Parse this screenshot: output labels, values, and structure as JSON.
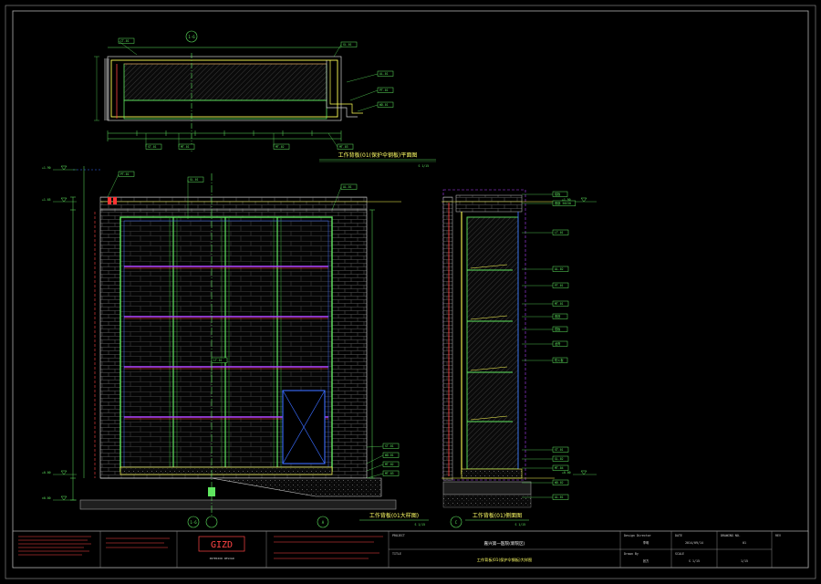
{
  "sheet": {
    "sheet_number": "01",
    "page": "1/15"
  },
  "views": {
    "plan": {
      "title": "工作背板(01(保护伞钢板)平面图",
      "scale": "S 1/15"
    },
    "front": {
      "title": "工作背板(01大样图)",
      "scale": "S 1/15"
    },
    "side": {
      "title": "工作背板(01)侧面图",
      "scale": "S 1/15"
    }
  },
  "section_markers": {
    "top": "1-6",
    "bottom": "1-6",
    "detail_a": "A",
    "detail_c": "C"
  },
  "levels": {
    "front": [
      "+1.90",
      "+1.65",
      "+0.00",
      "±0.00"
    ],
    "side": [
      "+1.90",
      "+0.00"
    ]
  },
  "annotations": {
    "plan": [
      "CT-01",
      "GL-01",
      "AL-01",
      "PT-01",
      "WD-01",
      "ST-01",
      "MT-01",
      "MT-02",
      "MT-03"
    ],
    "front": [
      "PT-01",
      "GL-01",
      "AL-01",
      "LT-01",
      "ST-01",
      "WD-01",
      "MT-02",
      "MT-03"
    ],
    "side": [
      "铝板",
      "角钢 30X30",
      "LT-01",
      "AL-02",
      "PT-01",
      "MT-01",
      "角铁",
      "层板",
      "龙骨",
      "防火板",
      "ST-01",
      "GL-02",
      "MT-04",
      "WD-02",
      "AL-01"
    ]
  },
  "title_block": {
    "project": "嘉兴第一医院(新院区)",
    "drawing_title": "工作背板(01(保护伞钢板)大样图",
    "date": "2014/09/14",
    "drawn_by": "李明",
    "checked_by": "张方",
    "logo_text": "GIZD",
    "logo_sub": "INTERIOR DESIGN",
    "labels": {
      "project": "PROJECT",
      "title": "TITLE",
      "design": "Design Director",
      "drawn": "Drawn By",
      "date": "DATE",
      "scale": "SCALE",
      "sheet": "DRAWING NO.",
      "rev": "REV"
    }
  }
}
